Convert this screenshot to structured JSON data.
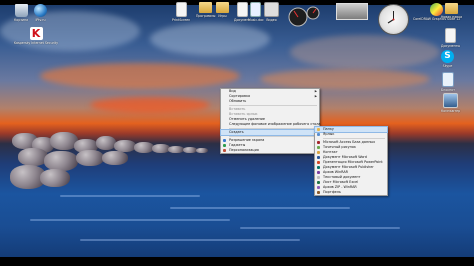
{
  "desktop": {
    "icons_left": [
      {
        "icon": "recycle-bin-icon",
        "label": "Корзина"
      },
      {
        "icon": "kaspersky-icon",
        "label": "Kaspersky Internet Security"
      }
    ],
    "icon_top_2": {
      "icon": "globe-icon",
      "label": "IPtv.ru"
    },
    "icons_top": [
      {
        "icon": "document-icon",
        "label": "PrintScreen"
      },
      {
        "icon": "folder-icon",
        "label": "Программы"
      },
      {
        "icon": "folder-icon",
        "label": "Игры"
      },
      {
        "icon": "document-icon",
        "label": "Документ"
      },
      {
        "icon": "document-icon",
        "label": "Music.doc"
      },
      {
        "icon": "video-icon",
        "label": "Видео"
      }
    ],
    "icons_right": [
      {
        "icon": "coreldraw-icon",
        "label": "CorelDRAW Graphics Suite 12"
      },
      {
        "icon": "folder-icon",
        "label": "Новая папка"
      },
      {
        "icon": "skype-icon",
        "label": "Skype"
      },
      {
        "icon": "notepad-icon",
        "label": "Блокнот"
      },
      {
        "icon": "folder-icon",
        "label": "Документы"
      },
      {
        "icon": "computer-icon",
        "label": "Компьютер"
      }
    ]
  },
  "context_menu": {
    "items": [
      {
        "label": "Вид",
        "submenu": true,
        "disabled": false
      },
      {
        "label": "Сортировка",
        "submenu": true,
        "disabled": false
      },
      {
        "label": "Обновить",
        "submenu": false,
        "disabled": false
      },
      {
        "sep": true
      },
      {
        "label": "Вставить",
        "submenu": false,
        "disabled": true
      },
      {
        "label": "Вставить ярлык",
        "submenu": false,
        "disabled": true
      },
      {
        "label": "Отменить удаление",
        "submenu": false,
        "disabled": false
      },
      {
        "label": "Следующее фоновое изображение рабочего стола",
        "submenu": false,
        "disabled": false
      },
      {
        "sep": true
      },
      {
        "label": "Создать",
        "submenu": true,
        "disabled": false,
        "highlighted": true
      },
      {
        "sep": true
      },
      {
        "label": "Разрешение экрана",
        "submenu": false,
        "disabled": false,
        "icon": "monitor-icon"
      },
      {
        "label": "Гаджеты",
        "submenu": false,
        "disabled": false,
        "icon": "gadgets-icon"
      },
      {
        "label": "Персонализация",
        "submenu": false,
        "disabled": false,
        "icon": "personalize-icon"
      }
    ]
  },
  "create_submenu": {
    "items": [
      {
        "label": "Папку",
        "icon": "folder-icon",
        "highlighted": true
      },
      {
        "label": "Ярлык",
        "icon": "shortcut-icon"
      },
      {
        "sep": true
      },
      {
        "label": "Microsoft Access База данных",
        "icon": "access-icon"
      },
      {
        "label": "Точечный рисунок",
        "icon": "bitmap-icon"
      },
      {
        "label": "Контакт",
        "icon": "contact-icon"
      },
      {
        "label": "Документ Microsoft Word",
        "icon": "word-icon"
      },
      {
        "label": "Презентация Microsoft PowerPoint",
        "icon": "powerpoint-icon"
      },
      {
        "label": "Документ Microsoft Publisher",
        "icon": "publisher-icon"
      },
      {
        "label": "Архив WinRAR",
        "icon": "winrar-icon"
      },
      {
        "label": "Текстовый документ",
        "icon": "text-icon"
      },
      {
        "label": "Лист Microsoft Excel",
        "icon": "excel-icon"
      },
      {
        "label": "Архив ZIP - WinRAR",
        "icon": "zip-icon"
      },
      {
        "label": "Портфель",
        "icon": "briefcase-icon"
      }
    ]
  }
}
